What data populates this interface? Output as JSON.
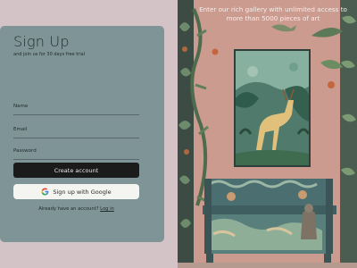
{
  "signup": {
    "title": "Sign Up",
    "subtitle": "and join us for 30 days free trial",
    "name_label": "Name",
    "email_label": "Email",
    "password_label": "Password",
    "create_button": "Create account",
    "google_button": "Sign up with Google",
    "login_prompt": "Already have an account?",
    "login_link": "Log in"
  },
  "hero": {
    "tagline": "Enter our rich gallery with unlimited access to more than 5000 pieces of art"
  },
  "colors": {
    "card_bg": "#7f9496",
    "page_bg": "#d3c3c6",
    "wall_pink": "#cf9f95",
    "primary_button": "#1b1b1b"
  },
  "icons": {
    "google": "google-logo-icon"
  }
}
